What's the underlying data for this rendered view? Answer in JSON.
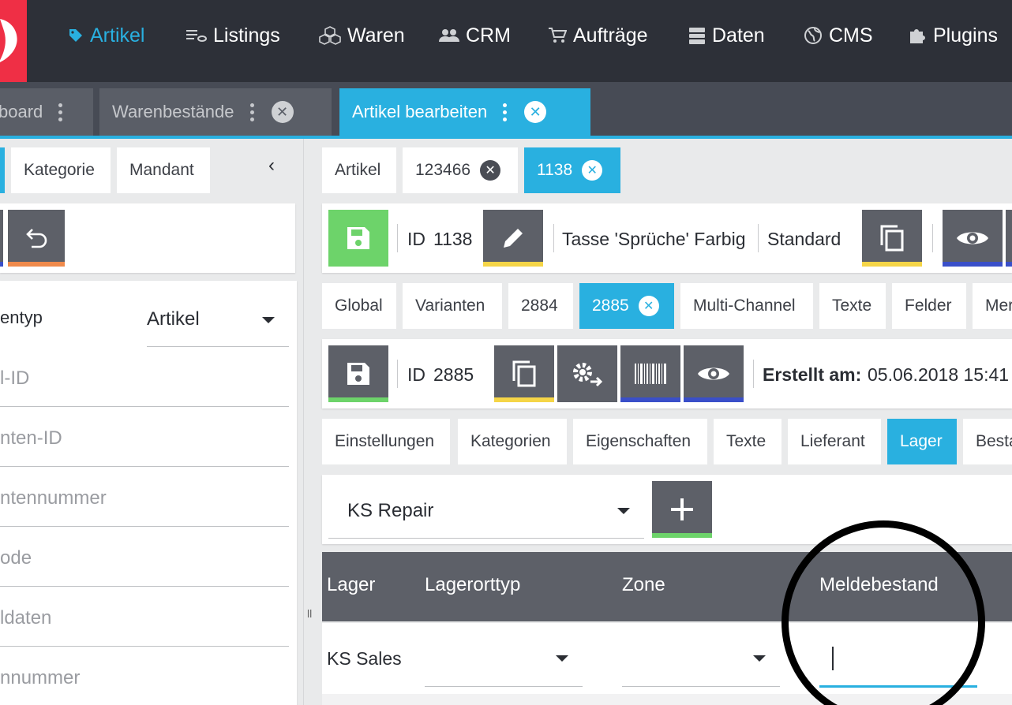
{
  "nav": {
    "items": [
      {
        "label": "Artikel",
        "icon": "tag-icon",
        "active": true
      },
      {
        "label": "Listings",
        "icon": "listings-icon"
      },
      {
        "label": "Waren",
        "icon": "boxes-icon"
      },
      {
        "label": "CRM",
        "icon": "people-icon"
      },
      {
        "label": "Aufträge",
        "icon": "cart-icon"
      },
      {
        "label": "Daten",
        "icon": "database-icon"
      },
      {
        "label": "CMS",
        "icon": "globe-icon"
      },
      {
        "label": "Plugins",
        "icon": "puzzle-icon"
      }
    ]
  },
  "tabs": {
    "dashboard": "board",
    "warenbestaende": "Warenbestände",
    "artikel_bearbeiten": "Artikel bearbeiten"
  },
  "left": {
    "tabs": [
      "Kategorie",
      "Mandant"
    ],
    "type_label": "entyp",
    "type_value": "Artikel",
    "fields": [
      "l-ID",
      "nten-ID",
      "ntennummer",
      "ode",
      "ldaten",
      "nnummer"
    ]
  },
  "breadcrumb": {
    "items": [
      "Artikel",
      "123466",
      "1138"
    ]
  },
  "article": {
    "id_label": "ID",
    "id_value": "1138",
    "name": "Tasse 'Sprüche' Farbig",
    "type": "Standard"
  },
  "variant_tabs": [
    "Global",
    "Varianten",
    "2884",
    "2885",
    "Multi-Channel",
    "Texte",
    "Felder",
    "Mer"
  ],
  "variant": {
    "id_label": "ID",
    "id_value": "2885",
    "created_label": "Erstellt am:",
    "created_value": "05.06.2018 15:41"
  },
  "detail_tabs": [
    "Einstellungen",
    "Kategorien",
    "Eigenschaften",
    "Texte",
    "Lieferant",
    "Lager",
    "Besta"
  ],
  "warehouse": {
    "selected": "KS Repair"
  },
  "table": {
    "headers": [
      "Lager",
      "Lagerorttyp",
      "Zone",
      "Meldebestand"
    ],
    "rows": [
      {
        "lager": "KS Sales",
        "lagerorttyp": "",
        "zone": "",
        "meldebestand": ""
      }
    ]
  },
  "colors": {
    "accent": "#29b0e0",
    "nav_bg": "#2d3038",
    "brand_red": "#ef2f45",
    "save_green": "#6dd36a",
    "yellow_bar": "#f5d547",
    "blue_bar": "#3a4fc9",
    "orange_bar": "#f08a4b"
  }
}
